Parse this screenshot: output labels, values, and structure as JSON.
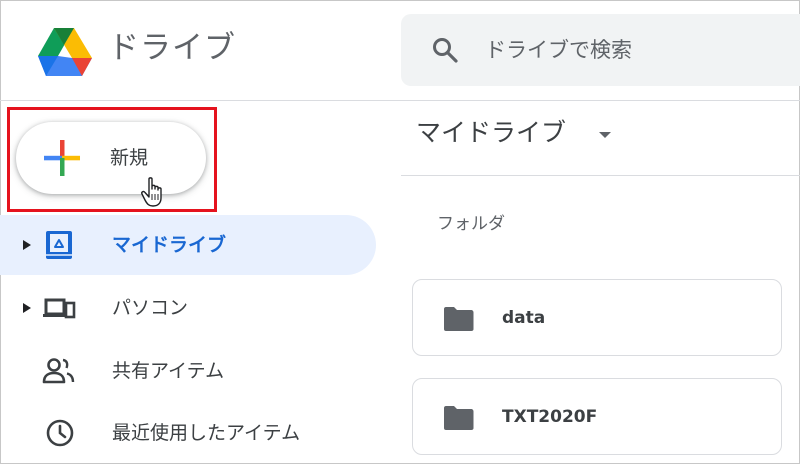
{
  "app": {
    "title": "ドライブ"
  },
  "search": {
    "placeholder": "ドライブで検索"
  },
  "new_button": {
    "label": "新規"
  },
  "sidebar": {
    "items": [
      {
        "label": "マイドライブ",
        "icon": "my-drive-icon",
        "active": true,
        "expandable": true
      },
      {
        "label": "パソコン",
        "icon": "computers-icon",
        "active": false,
        "expandable": true
      },
      {
        "label": "共有アイテム",
        "icon": "shared-people-icon",
        "active": false,
        "expandable": false
      },
      {
        "label": "最近使用したアイテム",
        "icon": "clock-icon",
        "active": false,
        "expandable": false
      }
    ]
  },
  "main": {
    "title": "マイドライブ",
    "section_label": "フォルダ",
    "folders": [
      {
        "name": "data",
        "icon": "folder-icon"
      },
      {
        "name": "TXT2020F",
        "icon": "folder-icon"
      }
    ]
  },
  "colors": {
    "accent": "#1967d2",
    "active_bg": "#e8f0fe",
    "search_bg": "#f1f3f4",
    "highlight": "#e5131e",
    "text": "#3c4043",
    "muted": "#5f6368"
  }
}
